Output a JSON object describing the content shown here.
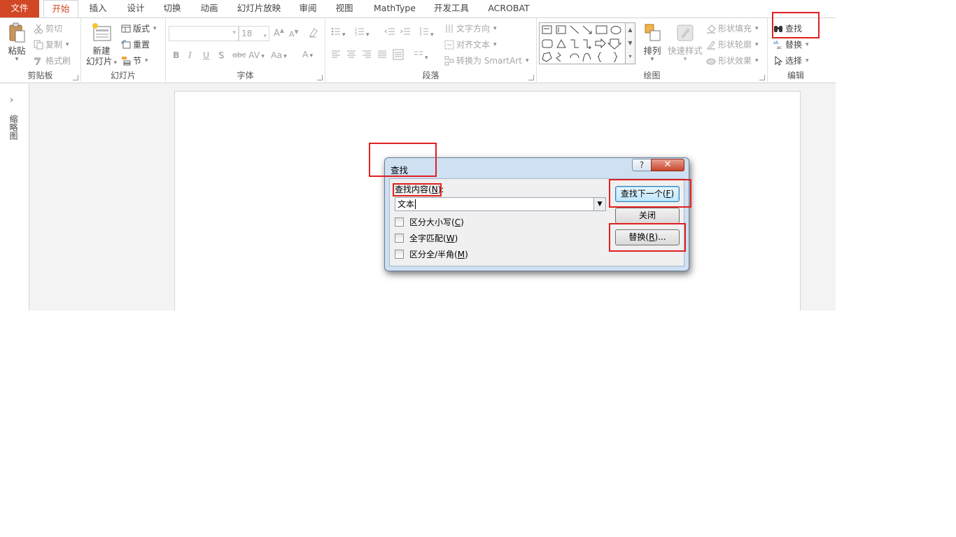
{
  "tabs": {
    "file": "文件",
    "home": "开始",
    "insert": "插入",
    "design": "设计",
    "transitions": "切换",
    "animations": "动画",
    "slideshow": "幻灯片放映",
    "review": "审阅",
    "view": "视图",
    "mathtype": "MathType",
    "developer": "开发工具",
    "acrobat": "ACROBAT"
  },
  "clipboard": {
    "paste": "粘贴",
    "cut": "剪切",
    "copy": "复制",
    "format_painter": "格式刷",
    "label": "剪贴板"
  },
  "slides": {
    "new_slide_line1": "新建",
    "new_slide_line2": "幻灯片",
    "layout": "版式",
    "reset": "重置",
    "section": "节",
    "label": "幻灯片"
  },
  "font": {
    "font_name": "",
    "font_size": "18",
    "bold": "B",
    "italic": "I",
    "underline": "U",
    "shadow": "S",
    "strike": "abc",
    "spacing": "AV",
    "case": "Aa",
    "color": "A",
    "grow": "A",
    "shrink": "A",
    "label": "字体"
  },
  "paragraph": {
    "text_direction": "文字方向",
    "align_text": "对齐文本",
    "smartart": "转换为 SmartArt",
    "label": "段落"
  },
  "drawing": {
    "arrange": "排列",
    "quick_styles": "快速样式",
    "shape_fill": "形状填充",
    "shape_outline": "形状轮廓",
    "shape_effects": "形状效果",
    "label": "绘图"
  },
  "editing": {
    "find": "查找",
    "replace": "替换",
    "select": "选择",
    "label": "编辑"
  },
  "thumbpane": {
    "vertical_label": "缩略图"
  },
  "dialog": {
    "title": "查找",
    "help": "?",
    "close": "✕",
    "find_what_label": "查找内容",
    "find_what_key": "N",
    "find_value": "文本",
    "match_case": "区分大小写",
    "match_case_key": "C",
    "whole_word": "全字匹配",
    "whole_word_key": "W",
    "match_width": "区分全/半角",
    "match_width_key": "M",
    "find_next": "查找下一个",
    "find_next_key": "F",
    "close_button": "关闭",
    "replace_button": "替换",
    "replace_key": "R",
    "replace_ellipsis": "..."
  },
  "colors": {
    "accent": "#d24726",
    "highlight": "#e02020",
    "dialog_frame": "#cfe0f3"
  }
}
